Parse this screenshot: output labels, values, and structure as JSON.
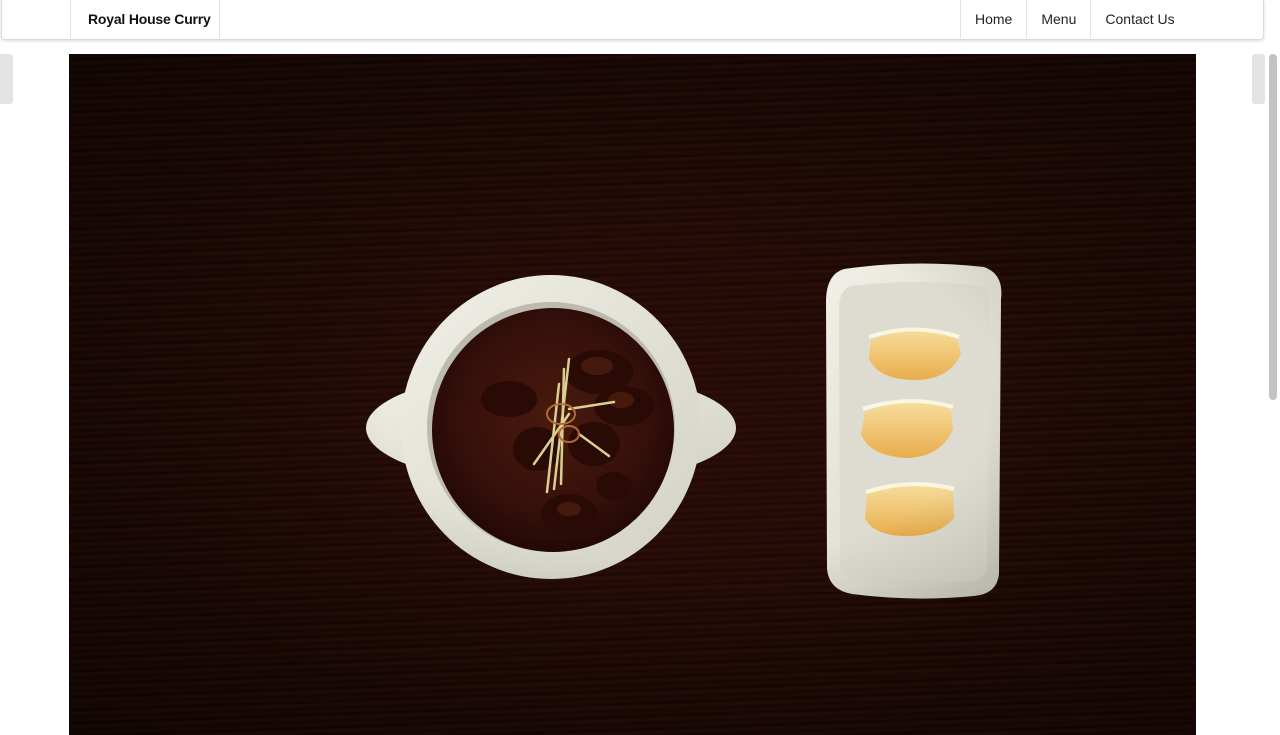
{
  "header": {
    "brand": "Royal House Curry",
    "nav": [
      "Home",
      "Menu",
      "Contact Us"
    ]
  },
  "hero": {
    "icon": "photo-curry-dish"
  },
  "colors": {
    "background": "#ffffff",
    "nav_border": "#e1e1e1",
    "wood": "#1e0a06",
    "bowl": "#e8e7dc",
    "curry": "#3b120a",
    "lemon": "#f0c26a"
  }
}
